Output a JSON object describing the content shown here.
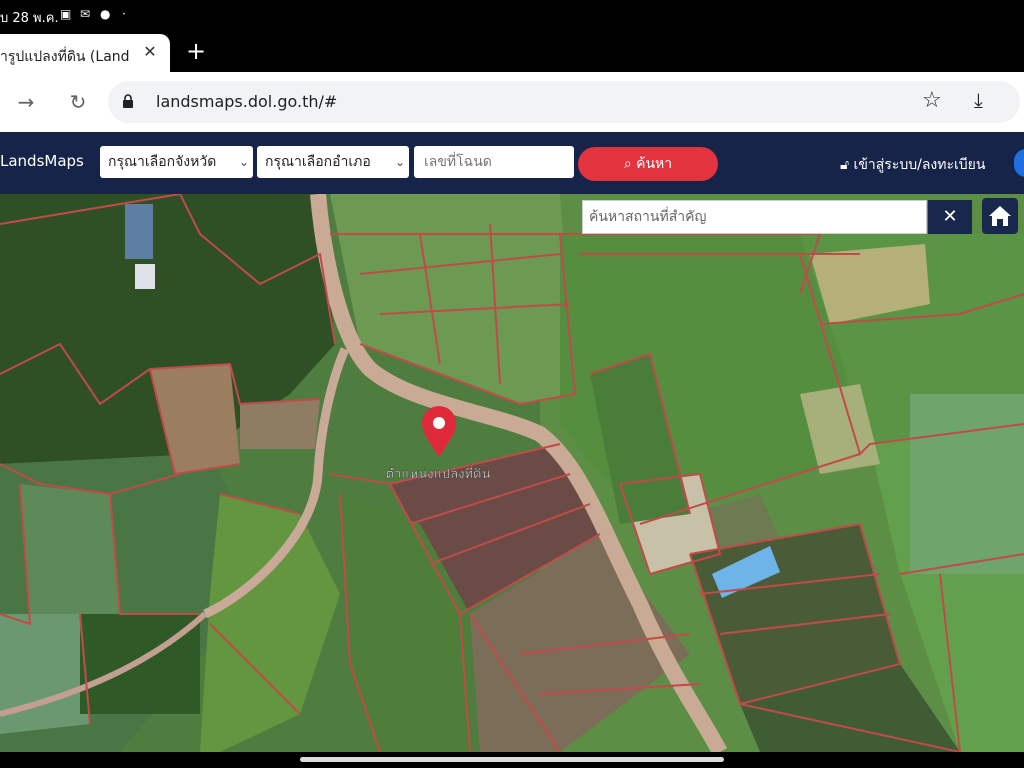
{
  "status_bar": {
    "time": "บ 28 พ.ค.",
    "icons": [
      "sim-card-icon",
      "notification-icon",
      "messenger-icon",
      "more-dot-icon"
    ]
  },
  "tab": {
    "title": "ารูปแปลงที่ดิน (Land",
    "close_icon": "close-icon",
    "new_tab_icon": "plus-icon"
  },
  "toolbar": {
    "url": "landsmaps.dol.go.th/#",
    "icons": [
      "forward-arrow-icon",
      "reload-icon",
      "lock-icon",
      "star-icon",
      "download-icon"
    ]
  },
  "site_header": {
    "brand": "LandsMaps",
    "province_select": "กรุณาเลือกจังหวัด",
    "district_select": "กรุณาเลือกอำเภอ",
    "parcel_placeholder": "เลขที่โฉนด",
    "search_button": "ค้นหา",
    "login_link": "เข้าสู่ระบบ/ลงทะเบียน",
    "colors": {
      "header_bg": "#16244a",
      "search_btn": "#e2333f"
    }
  },
  "map": {
    "place_search_placeholder": "ค้นหาสถานที่สำคัญ",
    "clear_icon": "close-icon",
    "home_icon": "home-icon",
    "marker_label": "ตำแหน่งแปลงที่ดิน",
    "marker_color": "#e0293a",
    "parcel_line_color": "#c24a4a"
  }
}
